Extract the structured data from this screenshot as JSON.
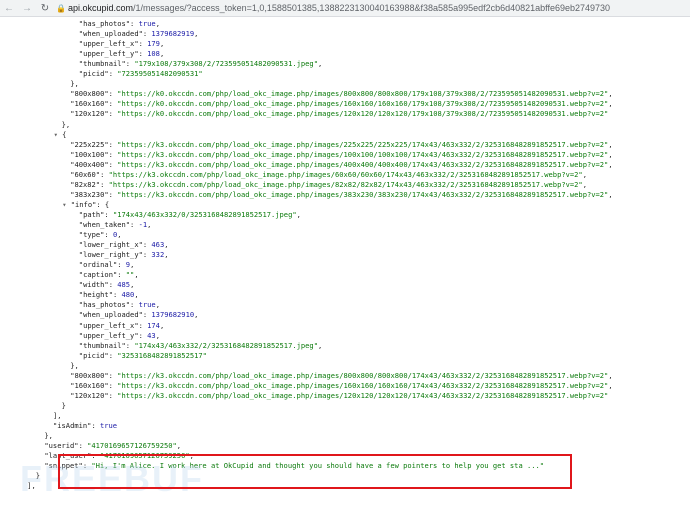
{
  "browser": {
    "url_host": "api.okcupid.com",
    "url_path": "/1/messages/?access_token=1,0,1588501385,1388223130040163988&f38a585a995edf2cb6d40821abffe69eb2749730",
    "back_icon": "arrow-left",
    "forward_icon": "arrow-right",
    "reload_icon": "reload",
    "lock_icon": "lock"
  },
  "json_view": {
    "lines": [
      {
        "indent": 15,
        "parts": [
          {
            "t": "\"has_photos\"",
            "c": "key"
          },
          {
            "t": ": ",
            "c": "punc"
          },
          {
            "t": "true",
            "c": "kw"
          },
          {
            "t": ",",
            "c": "punc"
          }
        ]
      },
      {
        "indent": 15,
        "parts": [
          {
            "t": "\"when_uploaded\"",
            "c": "key"
          },
          {
            "t": ": ",
            "c": "punc"
          },
          {
            "t": "1379682919",
            "c": "num"
          },
          {
            "t": ",",
            "c": "punc"
          }
        ]
      },
      {
        "indent": 15,
        "parts": [
          {
            "t": "\"upper_left_x\"",
            "c": "key"
          },
          {
            "t": ": ",
            "c": "punc"
          },
          {
            "t": "179",
            "c": "num"
          },
          {
            "t": ",",
            "c": "punc"
          }
        ]
      },
      {
        "indent": 15,
        "parts": [
          {
            "t": "\"upper_left_y\"",
            "c": "key"
          },
          {
            "t": ": ",
            "c": "punc"
          },
          {
            "t": "108",
            "c": "num"
          },
          {
            "t": ",",
            "c": "punc"
          }
        ]
      },
      {
        "indent": 15,
        "parts": [
          {
            "t": "\"thumbnail\"",
            "c": "key"
          },
          {
            "t": ": ",
            "c": "punc"
          },
          {
            "t": "\"179x108/379x308/2/723595051482090531.jpeg\"",
            "c": "str"
          },
          {
            "t": ",",
            "c": "punc"
          }
        ]
      },
      {
        "indent": 15,
        "parts": [
          {
            "t": "\"picid\"",
            "c": "key"
          },
          {
            "t": ": ",
            "c": "punc"
          },
          {
            "t": "\"723595051482090531\"",
            "c": "str"
          }
        ]
      },
      {
        "indent": 13,
        "parts": [
          {
            "t": "},",
            "c": "punc"
          }
        ]
      },
      {
        "indent": 13,
        "parts": [
          {
            "t": "\"800x800\"",
            "c": "key"
          },
          {
            "t": ": ",
            "c": "punc"
          },
          {
            "t": "\"https://k0.okccdn.com/php/load_okc_image.php/images/800x800/800x800/179x108/379x308/2/723595051482090531.webp?v=2\"",
            "c": "str"
          },
          {
            "t": ",",
            "c": "punc"
          }
        ]
      },
      {
        "indent": 13,
        "parts": [
          {
            "t": "\"160x160\"",
            "c": "key"
          },
          {
            "t": ": ",
            "c": "punc"
          },
          {
            "t": "\"https://k0.okccdn.com/php/load_okc_image.php/images/160x160/160x160/179x108/379x308/2/723595051482090531.webp?v=2\"",
            "c": "str"
          },
          {
            "t": ",",
            "c": "punc"
          }
        ]
      },
      {
        "indent": 13,
        "parts": [
          {
            "t": "\"120x120\"",
            "c": "key"
          },
          {
            "t": ": ",
            "c": "punc"
          },
          {
            "t": "\"https://k0.okccdn.com/php/load_okc_image.php/images/120x120/120x120/179x108/379x308/2/723595051482090531.webp?v=2\"",
            "c": "str"
          }
        ]
      },
      {
        "indent": 11,
        "parts": [
          {
            "t": "},",
            "c": "punc"
          }
        ]
      },
      {
        "indent": 11,
        "caret": true,
        "parts": [
          {
            "t": "{",
            "c": "punc"
          }
        ]
      },
      {
        "indent": 13,
        "parts": [
          {
            "t": "\"225x225\"",
            "c": "key"
          },
          {
            "t": ": ",
            "c": "punc"
          },
          {
            "t": "\"https://k3.okccdn.com/php/load_okc_image.php/images/225x225/225x225/174x43/463x332/2/3253168482891852517.webp?v=2\"",
            "c": "str"
          },
          {
            "t": ",",
            "c": "punc"
          }
        ]
      },
      {
        "indent": 13,
        "parts": [
          {
            "t": "\"100x100\"",
            "c": "key"
          },
          {
            "t": ": ",
            "c": "punc"
          },
          {
            "t": "\"https://k3.okccdn.com/php/load_okc_image.php/images/100x100/100x100/174x43/463x332/2/3253168482891852517.webp?v=2\"",
            "c": "str"
          },
          {
            "t": ",",
            "c": "punc"
          }
        ]
      },
      {
        "indent": 13,
        "parts": [
          {
            "t": "\"400x400\"",
            "c": "key"
          },
          {
            "t": ": ",
            "c": "punc"
          },
          {
            "t": "\"https://k3.okccdn.com/php/load_okc_image.php/images/400x400/400x400/174x43/463x332/2/3253168482891852517.webp?v=2\"",
            "c": "str"
          },
          {
            "t": ",",
            "c": "punc"
          }
        ]
      },
      {
        "indent": 13,
        "parts": [
          {
            "t": "\"60x60\"",
            "c": "key"
          },
          {
            "t": ": ",
            "c": "punc"
          },
          {
            "t": "\"https://k3.okccdn.com/php/load_okc_image.php/images/60x60/60x60/174x43/463x332/2/3253168482891852517.webp?v=2\"",
            "c": "str"
          },
          {
            "t": ",",
            "c": "punc"
          }
        ]
      },
      {
        "indent": 13,
        "parts": [
          {
            "t": "\"82x82\"",
            "c": "key"
          },
          {
            "t": ": ",
            "c": "punc"
          },
          {
            "t": "\"https://k3.okccdn.com/php/load_okc_image.php/images/82x82/82x82/174x43/463x332/2/3253168482891852517.webp?v=2\"",
            "c": "str"
          },
          {
            "t": ",",
            "c": "punc"
          }
        ]
      },
      {
        "indent": 13,
        "parts": [
          {
            "t": "\"383x230\"",
            "c": "key"
          },
          {
            "t": ": ",
            "c": "punc"
          },
          {
            "t": "\"https://k3.okccdn.com/php/load_okc_image.php/images/383x230/383x230/174x43/463x332/2/3253168482891852517.webp?v=2\"",
            "c": "str"
          },
          {
            "t": ",",
            "c": "punc"
          }
        ]
      },
      {
        "indent": 13,
        "caret": true,
        "parts": [
          {
            "t": "\"info\"",
            "c": "key"
          },
          {
            "t": ": {",
            "c": "punc"
          }
        ]
      },
      {
        "indent": 15,
        "parts": [
          {
            "t": "\"path\"",
            "c": "key"
          },
          {
            "t": ": ",
            "c": "punc"
          },
          {
            "t": "\"174x43/463x332/0/3253168482891852517.jpeg\"",
            "c": "str"
          },
          {
            "t": ",",
            "c": "punc"
          }
        ]
      },
      {
        "indent": 15,
        "parts": [
          {
            "t": "\"when_taken\"",
            "c": "key"
          },
          {
            "t": ": ",
            "c": "punc"
          },
          {
            "t": "-1",
            "c": "num"
          },
          {
            "t": ",",
            "c": "punc"
          }
        ]
      },
      {
        "indent": 15,
        "parts": [
          {
            "t": "\"type\"",
            "c": "key"
          },
          {
            "t": ": ",
            "c": "punc"
          },
          {
            "t": "0",
            "c": "num"
          },
          {
            "t": ",",
            "c": "punc"
          }
        ]
      },
      {
        "indent": 15,
        "parts": [
          {
            "t": "\"lower_right_x\"",
            "c": "key"
          },
          {
            "t": ": ",
            "c": "punc"
          },
          {
            "t": "463",
            "c": "num"
          },
          {
            "t": ",",
            "c": "punc"
          }
        ]
      },
      {
        "indent": 15,
        "parts": [
          {
            "t": "\"lower_right_y\"",
            "c": "key"
          },
          {
            "t": ": ",
            "c": "punc"
          },
          {
            "t": "332",
            "c": "num"
          },
          {
            "t": ",",
            "c": "punc"
          }
        ]
      },
      {
        "indent": 15,
        "parts": [
          {
            "t": "\"ordinal\"",
            "c": "key"
          },
          {
            "t": ": ",
            "c": "punc"
          },
          {
            "t": "9",
            "c": "num"
          },
          {
            "t": ",",
            "c": "punc"
          }
        ]
      },
      {
        "indent": 15,
        "parts": [
          {
            "t": "\"caption\"",
            "c": "key"
          },
          {
            "t": ": ",
            "c": "punc"
          },
          {
            "t": "\"\"",
            "c": "str"
          },
          {
            "t": ",",
            "c": "punc"
          }
        ]
      },
      {
        "indent": 15,
        "parts": [
          {
            "t": "\"width\"",
            "c": "key"
          },
          {
            "t": ": ",
            "c": "punc"
          },
          {
            "t": "485",
            "c": "num"
          },
          {
            "t": ",",
            "c": "punc"
          }
        ]
      },
      {
        "indent": 15,
        "parts": [
          {
            "t": "\"height\"",
            "c": "key"
          },
          {
            "t": ": ",
            "c": "punc"
          },
          {
            "t": "480",
            "c": "num"
          },
          {
            "t": ",",
            "c": "punc"
          }
        ]
      },
      {
        "indent": 15,
        "parts": [
          {
            "t": "\"has_photos\"",
            "c": "key"
          },
          {
            "t": ": ",
            "c": "punc"
          },
          {
            "t": "true",
            "c": "kw"
          },
          {
            "t": ",",
            "c": "punc"
          }
        ]
      },
      {
        "indent": 15,
        "parts": [
          {
            "t": "\"when_uploaded\"",
            "c": "key"
          },
          {
            "t": ": ",
            "c": "punc"
          },
          {
            "t": "1379682910",
            "c": "num"
          },
          {
            "t": ",",
            "c": "punc"
          }
        ]
      },
      {
        "indent": 15,
        "parts": [
          {
            "t": "\"upper_left_x\"",
            "c": "key"
          },
          {
            "t": ": ",
            "c": "punc"
          },
          {
            "t": "174",
            "c": "num"
          },
          {
            "t": ",",
            "c": "punc"
          }
        ]
      },
      {
        "indent": 15,
        "parts": [
          {
            "t": "\"upper_left_y\"",
            "c": "key"
          },
          {
            "t": ": ",
            "c": "punc"
          },
          {
            "t": "43",
            "c": "num"
          },
          {
            "t": ",",
            "c": "punc"
          }
        ]
      },
      {
        "indent": 15,
        "parts": [
          {
            "t": "\"thumbnail\"",
            "c": "key"
          },
          {
            "t": ": ",
            "c": "punc"
          },
          {
            "t": "\"174x43/463x332/2/3253168482891852517.jpeg\"",
            "c": "str"
          },
          {
            "t": ",",
            "c": "punc"
          }
        ]
      },
      {
        "indent": 15,
        "parts": [
          {
            "t": "\"picid\"",
            "c": "key"
          },
          {
            "t": ": ",
            "c": "punc"
          },
          {
            "t": "\"3253168482891852517\"",
            "c": "str"
          }
        ]
      },
      {
        "indent": 13,
        "parts": [
          {
            "t": "},",
            "c": "punc"
          }
        ]
      },
      {
        "indent": 13,
        "parts": [
          {
            "t": "\"800x800\"",
            "c": "key"
          },
          {
            "t": ": ",
            "c": "punc"
          },
          {
            "t": "\"https://k3.okccdn.com/php/load_okc_image.php/images/800x800/800x800/174x43/463x332/2/3253168482891852517.webp?v=2\"",
            "c": "str"
          },
          {
            "t": ",",
            "c": "punc"
          }
        ]
      },
      {
        "indent": 13,
        "parts": [
          {
            "t": "\"160x160\"",
            "c": "key"
          },
          {
            "t": ": ",
            "c": "punc"
          },
          {
            "t": "\"https://k3.okccdn.com/php/load_okc_image.php/images/160x160/160x160/174x43/463x332/2/3253168482891852517.webp?v=2\"",
            "c": "str"
          },
          {
            "t": ",",
            "c": "punc"
          }
        ]
      },
      {
        "indent": 13,
        "parts": [
          {
            "t": "\"120x120\"",
            "c": "key"
          },
          {
            "t": ": ",
            "c": "punc"
          },
          {
            "t": "\"https://k3.okccdn.com/php/load_okc_image.php/images/120x120/120x120/174x43/463x332/2/3253168482891852517.webp?v=2\"",
            "c": "str"
          }
        ]
      },
      {
        "indent": 11,
        "parts": [
          {
            "t": "}",
            "c": "punc"
          }
        ]
      },
      {
        "indent": 9,
        "parts": [
          {
            "t": "],",
            "c": "punc"
          }
        ]
      },
      {
        "indent": 9,
        "parts": [
          {
            "t": "\"isAdmin\"",
            "c": "key"
          },
          {
            "t": ": ",
            "c": "punc"
          },
          {
            "t": "true",
            "c": "kw"
          }
        ]
      },
      {
        "indent": 7,
        "parts": [
          {
            "t": "},",
            "c": "punc"
          }
        ]
      },
      {
        "indent": 7,
        "parts": [
          {
            "t": "\"userid\"",
            "c": "key"
          },
          {
            "t": ": ",
            "c": "punc"
          },
          {
            "t": "\"4170169657126759250\"",
            "c": "str"
          },
          {
            "t": ",",
            "c": "punc"
          }
        ]
      },
      {
        "indent": 7,
        "parts": [
          {
            "t": "\"last_user\"",
            "c": "key"
          },
          {
            "t": ": ",
            "c": "punc"
          },
          {
            "t": "\"4170169657126759250\"",
            "c": "str"
          },
          {
            "t": ",",
            "c": "punc"
          }
        ]
      },
      {
        "indent": 7,
        "parts": [
          {
            "t": "\"snippet\"",
            "c": "key"
          },
          {
            "t": ": ",
            "c": "punc"
          },
          {
            "t": "\"Hi, I'm Alice. I work here at OkCupid and thought you should have a few pointers to help you get sta ...\"",
            "c": "str"
          }
        ]
      },
      {
        "indent": 5,
        "parts": [
          {
            "t": "}",
            "c": "punc"
          }
        ]
      },
      {
        "indent": 3,
        "parts": [
          {
            "t": "],",
            "c": "punc"
          }
        ]
      }
    ]
  },
  "highlight_color": "#e0161b",
  "watermark": "FREEBUF"
}
